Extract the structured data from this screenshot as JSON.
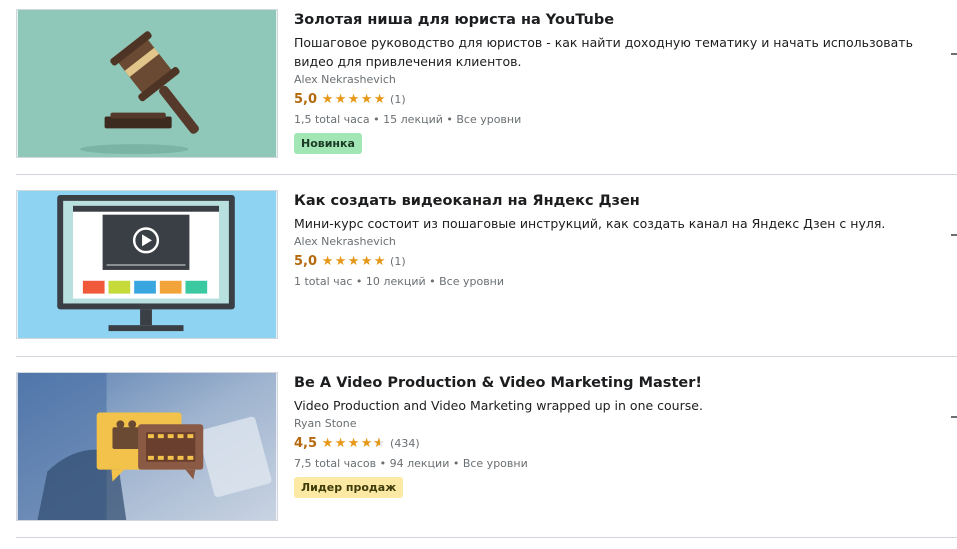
{
  "courses": [
    {
      "title": "Золотая ниша для юриста на YouTube",
      "description": [
        "Пошаговое руководство для юристов - как найти доходную тематику и начать использовать",
        "видео для привлечения клиентов."
      ],
      "author": "Alex Nekrashevich",
      "rating": "5,0",
      "rating_value": 5.0,
      "rating_count": "(1)",
      "meta": "1,5 total часа • 15 лекций • Все уровни",
      "badge": "Новинка",
      "thumbnail_icon": "gavel-icon"
    },
    {
      "title": "Как создать видеоканал на Яндекс Дзен",
      "description": [
        "Мини-курс состоит из пошаговые инструкций, как создать канал на Яндекс Дзен с нуля."
      ],
      "author": "Alex Nekrashevich",
      "rating": "5,0",
      "rating_value": 5.0,
      "rating_count": "(1)",
      "meta": "1 total час • 10 лекций • Все уровни",
      "badge": "",
      "thumbnail_icon": "monitor-video-icon"
    },
    {
      "title": "Be A Video Production & Video Marketing Master!",
      "description": [
        "Video Production and Video Marketing wrapped up in one course."
      ],
      "author": "Ryan Stone",
      "rating": "4,5",
      "rating_value": 4.5,
      "rating_count": "(434)",
      "meta": "7,5 total часов • 94 лекции • Все уровни",
      "badge": "Лидер продаж",
      "thumbnail_icon": "video-camera-chat-icon"
    }
  ],
  "colors": {
    "rating": "#b4690e",
    "star": "#e59819",
    "badge_new": "#a3e6b5",
    "badge_bestseller": "#fce9a3"
  }
}
